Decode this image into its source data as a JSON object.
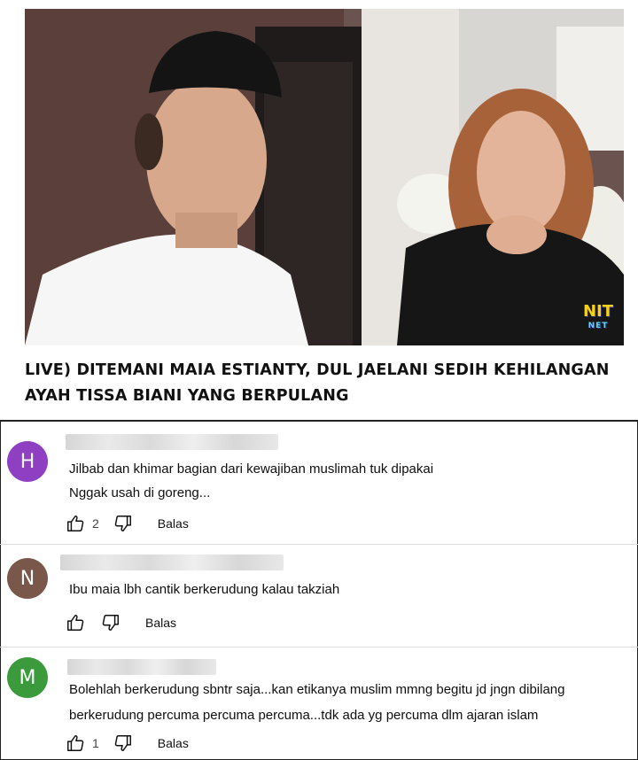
{
  "video": {
    "title_line1": "LIVE) DITEMANI MAIA ESTIANTY, DUL JAELANI SEDIH KEHILANGAN",
    "title_line2": "AYAH TISSA BIANI YANG BERPULANG",
    "logo_text": "NIT",
    "logo_sub": "NET"
  },
  "comments": [
    {
      "avatar_letter": "H",
      "avatar_color": "#8e3fc2",
      "text_lines": [
        "Jilbab dan khimar bagian dari kewajiban muslimah tuk dipakai",
        "Nggak usah di goreng..."
      ],
      "like_count": "2",
      "reply_label": "Balas"
    },
    {
      "avatar_letter": "N",
      "avatar_color": "#7a574b",
      "text_lines": [
        "Ibu maia lbh cantik berkerudung kalau takziah"
      ],
      "like_count": "",
      "reply_label": "Balas"
    },
    {
      "avatar_letter": "M",
      "avatar_color": "#3a9a3c",
      "text_lines": [
        "Bolehlah berkerudung sbntr saja...kan etikanya muslim mmng begitu jd jngn dibilang",
        "berkerudung percuma percuma percuma...tdk ada yg percuma dlm ajaran islam"
      ],
      "like_count": "1",
      "reply_label": "Balas"
    }
  ]
}
